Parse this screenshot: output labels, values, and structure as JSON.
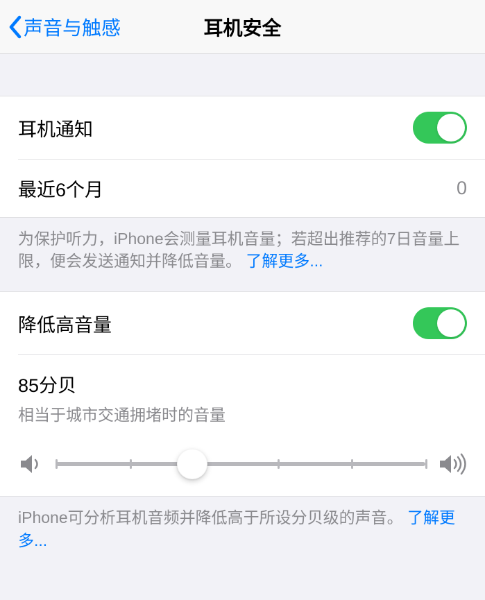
{
  "nav": {
    "back_label": "声音与触感",
    "title": "耳机安全"
  },
  "group1": {
    "notify_label": "耳机通知",
    "notify_on": true,
    "recent_label": "最近6个月",
    "recent_value": "0",
    "footer_text": "为保护听力，iPhone会测量耳机音量；若超出推荐的7日音量上限，便会发送通知并降低音量。",
    "footer_link": "了解更多..."
  },
  "group2": {
    "reduce_label": "降低高音量",
    "reduce_on": true,
    "db_label": "85分贝",
    "db_sub": "相当于城市交通拥堵时的音量",
    "slider_percent": 37,
    "footer_text": "iPhone可分析耳机音频并降低高于所设分贝级的声音。",
    "footer_link": "了解更多..."
  }
}
